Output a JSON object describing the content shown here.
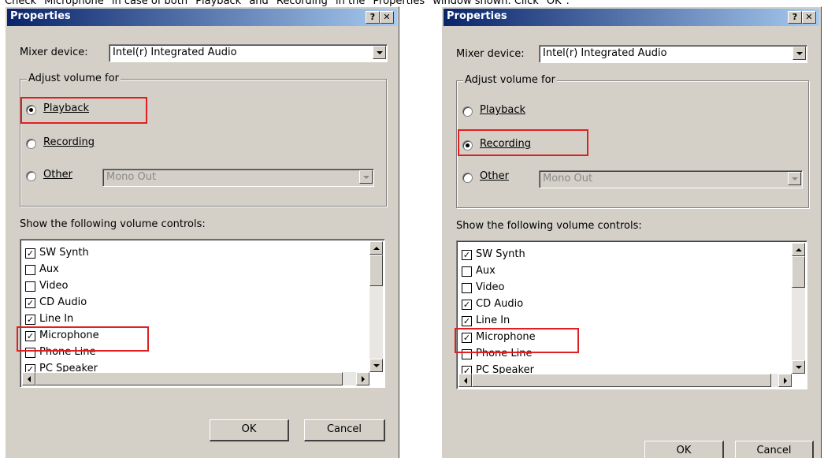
{
  "caption": "Check \"Microphone\" in case of both \"Playback\" and \"Recording\" in the \"Properties\" window shown. Click \"OK\".",
  "colors": {
    "titlebar_start": "#0a246a",
    "titlebar_end": "#a6caf0",
    "highlight": "#e02020",
    "face": "#d4d0c8"
  },
  "icons": {
    "help": "question-mark",
    "close": "x-mark"
  },
  "dialogs": [
    {
      "title": "Properties",
      "help_label": "?",
      "close_label": "✕",
      "mixer_label": "Mixer device:",
      "mixer_value": "Intel(r) Integrated Audio",
      "group_title": "Adjust volume for",
      "radios": [
        {
          "label": "Playback",
          "checked": true
        },
        {
          "label": "Recording",
          "checked": false
        },
        {
          "label": "Other",
          "checked": false
        }
      ],
      "other_value": "Mono Out",
      "controls_label": "Show the following volume controls:",
      "items": [
        {
          "label": "SW Synth",
          "mark": "✓"
        },
        {
          "label": "Aux",
          "mark": ""
        },
        {
          "label": "Video",
          "mark": ""
        },
        {
          "label": "CD Audio",
          "mark": "✓"
        },
        {
          "label": "Line In",
          "mark": "✓"
        },
        {
          "label": "Microphone",
          "mark": "✓"
        },
        {
          "label": "Phone Line",
          "mark": ""
        },
        {
          "label": "PC Speaker",
          "mark": "✓"
        }
      ],
      "ok_label": "OK",
      "cancel_label": "Cancel",
      "highlighted_option": "Playback"
    },
    {
      "title": "Properties",
      "help_label": "?",
      "close_label": "✕",
      "mixer_label": "Mixer device:",
      "mixer_value": "Intel(r) Integrated Audio",
      "group_title": "Adjust volume for",
      "radios": [
        {
          "label": "Playback",
          "checked": false
        },
        {
          "label": "Recording",
          "checked": true
        },
        {
          "label": "Other",
          "checked": false
        }
      ],
      "other_value": "Mono Out",
      "controls_label": "Show the following volume controls:",
      "items": [
        {
          "label": "SW Synth",
          "mark": "✓"
        },
        {
          "label": "Aux",
          "mark": ""
        },
        {
          "label": "Video",
          "mark": ""
        },
        {
          "label": "CD Audio",
          "mark": "✓"
        },
        {
          "label": "Line In",
          "mark": "✓"
        },
        {
          "label": "Microphone",
          "mark": "✓"
        },
        {
          "label": "Phone Line",
          "mark": ""
        },
        {
          "label": "PC Speaker",
          "mark": "✓"
        }
      ],
      "ok_label": "OK",
      "cancel_label": "Cancel",
      "highlighted_option": "Recording"
    }
  ]
}
